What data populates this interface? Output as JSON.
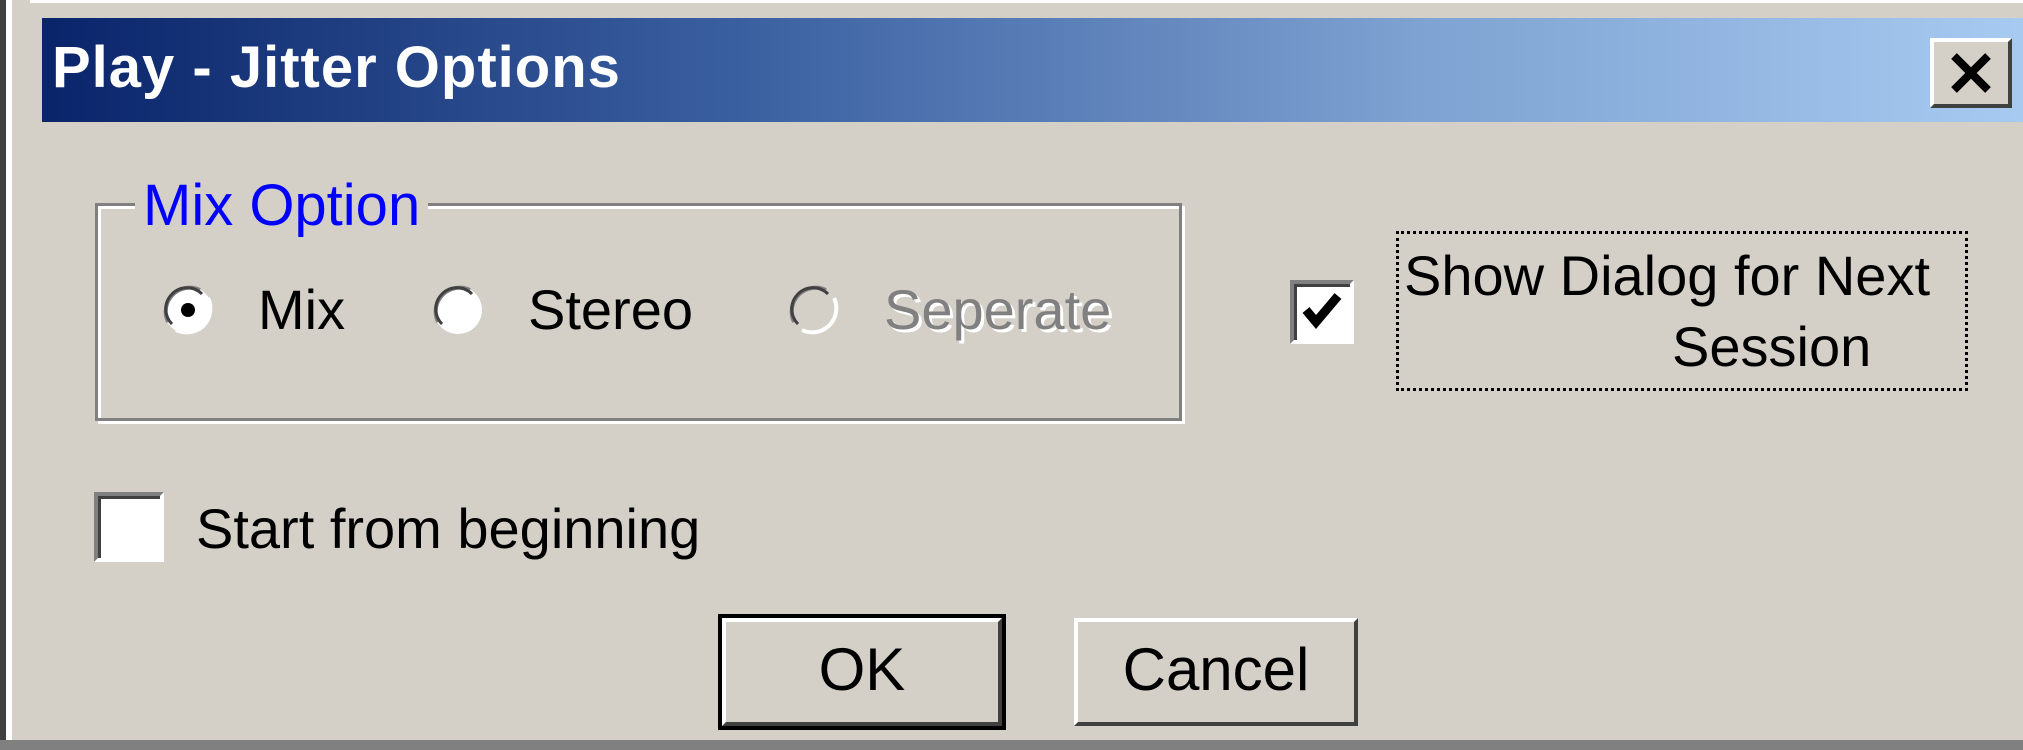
{
  "window": {
    "title": "Play - Jitter Options"
  },
  "titlebar": {
    "close_icon": "close-x-icon"
  },
  "mix_option": {
    "legend": "Mix Option",
    "options": [
      {
        "label": "Mix",
        "selected": true,
        "enabled": true
      },
      {
        "label": "Stereo",
        "selected": false,
        "enabled": true
      },
      {
        "label": "Seperate",
        "selected": false,
        "enabled": false
      }
    ]
  },
  "show_dialog": {
    "label_line1": "Show Dialog for Next",
    "label_line2": "Session",
    "checked": true
  },
  "start_from_beginning": {
    "label": "Start from beginning",
    "checked": false
  },
  "buttons": {
    "ok_label": "OK",
    "cancel_label": "Cancel"
  },
  "colors": {
    "dialog_bg": "#d4d0c8",
    "title_start": "#0a246a",
    "title_end": "#a6caf0",
    "legend_text": "#0000ff"
  }
}
